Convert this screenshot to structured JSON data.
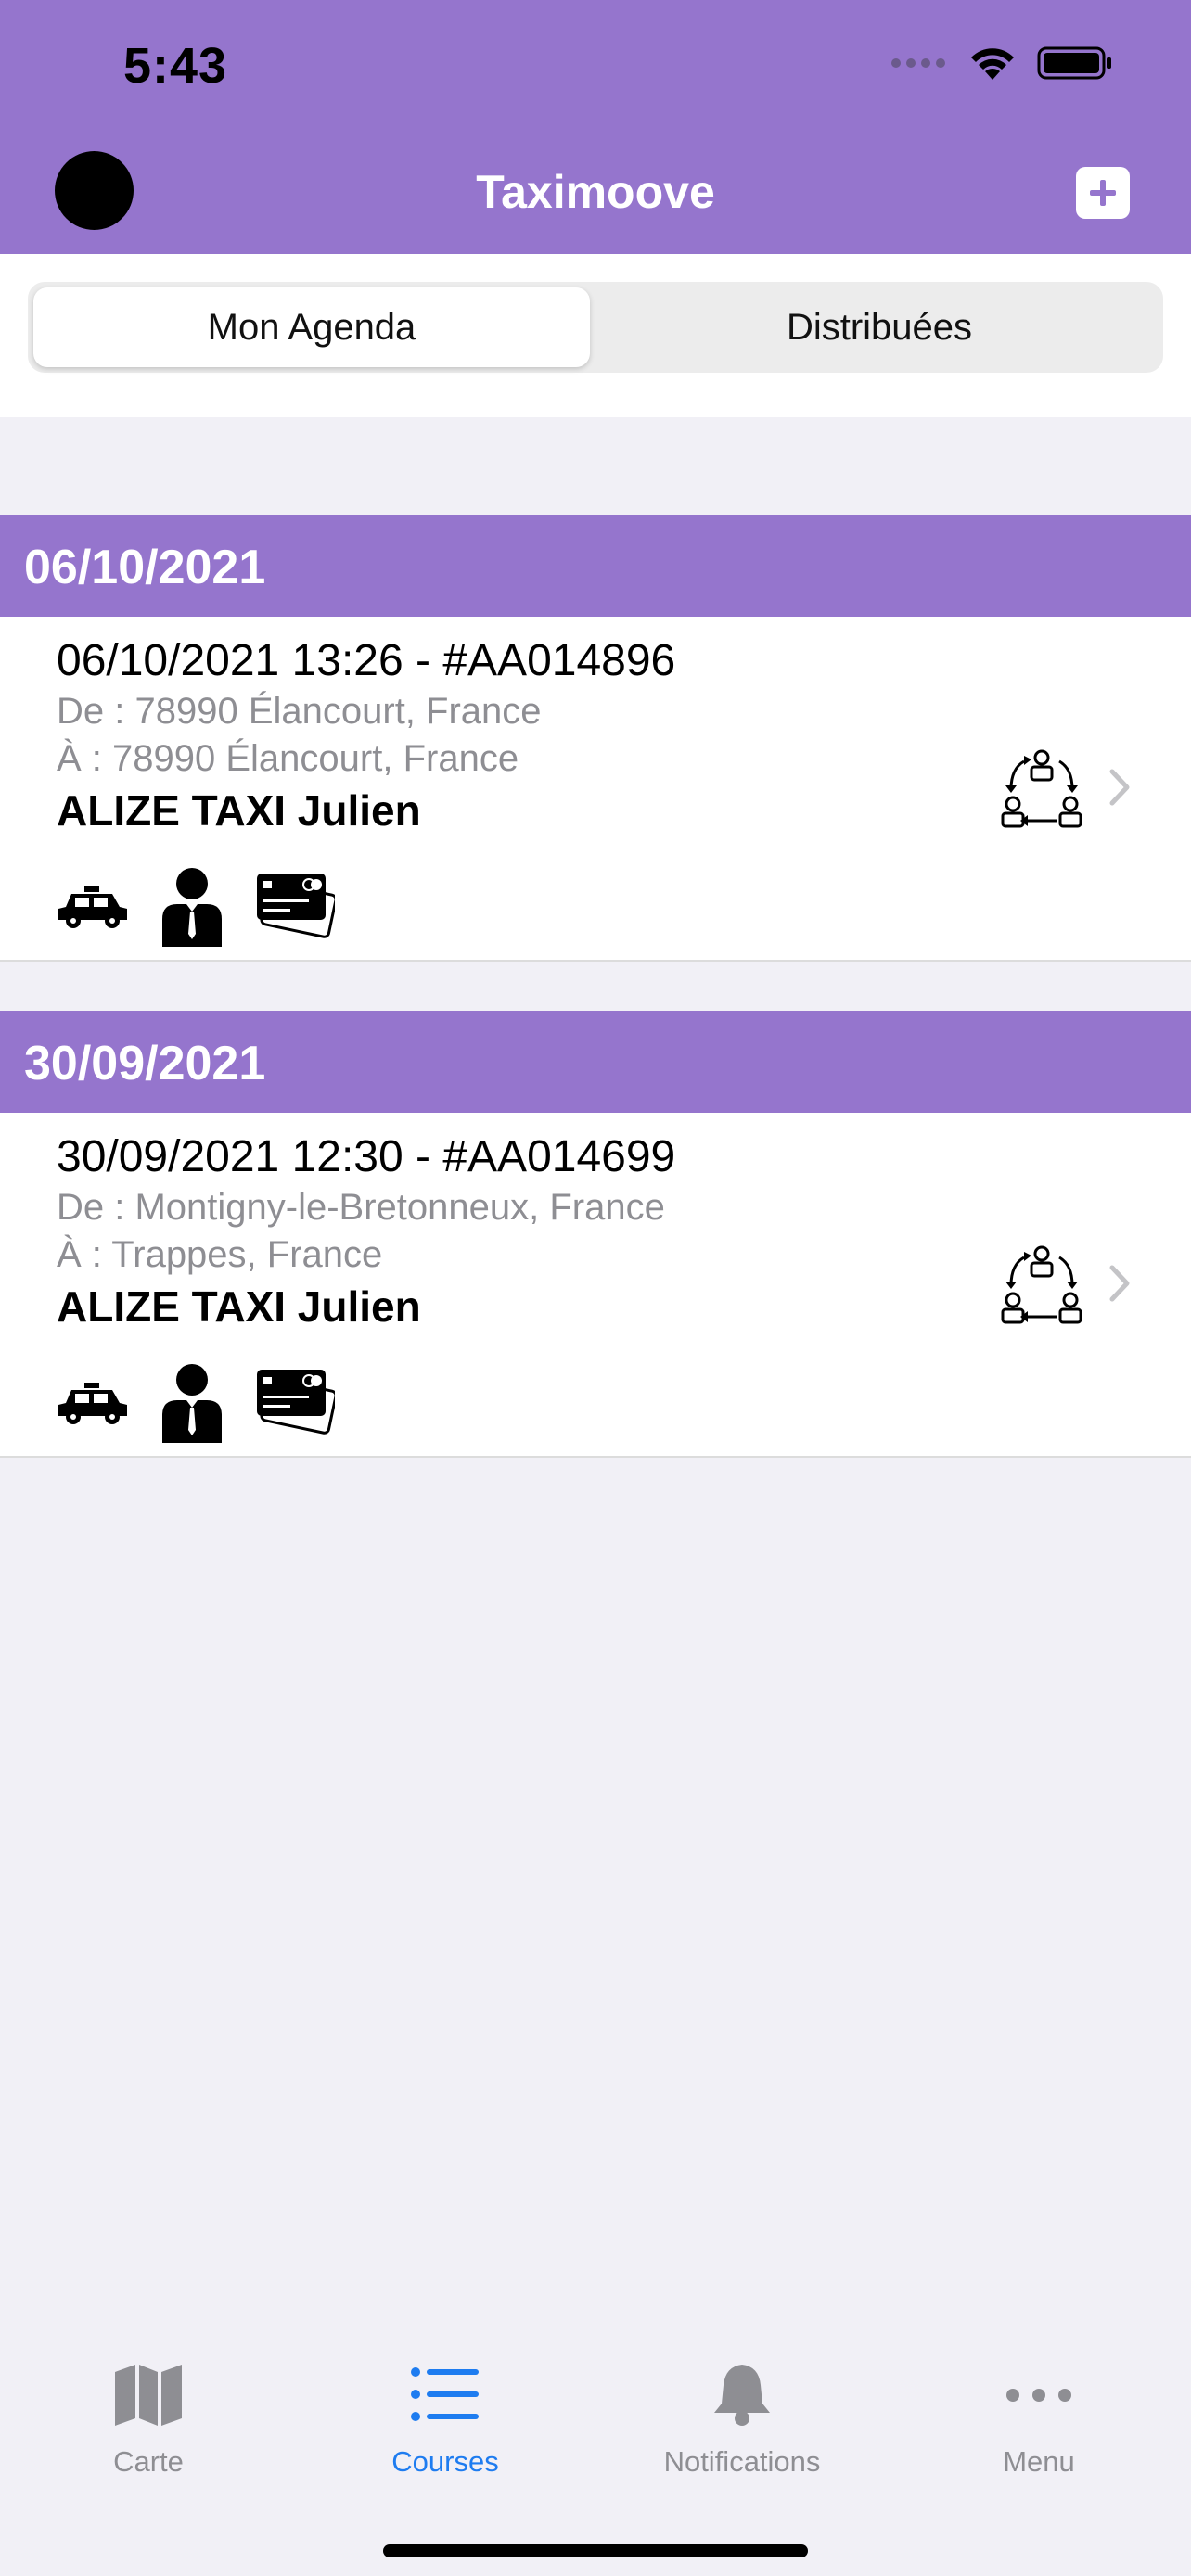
{
  "status_bar": {
    "time": "5:43",
    "icons": [
      "signal-dots-icon",
      "wifi-icon",
      "battery-icon"
    ]
  },
  "nav": {
    "title": "Taximoove",
    "add_icon": "plus-icon"
  },
  "segments": [
    {
      "label": "Mon Agenda",
      "selected": true
    },
    {
      "label": "Distribuées",
      "selected": false
    }
  ],
  "sections": [
    {
      "date": "06/10/2021",
      "rides": [
        {
          "header": "06/10/2021 13:26 - #AA014896",
          "from": "De : 78990 Élancourt, France",
          "to": "À : 78990 Élancourt, France",
          "driver": "ALIZE TAXI Julien",
          "icons": [
            "taxi-car-icon",
            "passenger-icon",
            "credit-card-icon"
          ]
        }
      ]
    },
    {
      "date": "30/09/2021",
      "rides": [
        {
          "header": "30/09/2021 12:30 - #AA014699",
          "from": "De : Montigny-le-Bretonneux, France",
          "to": "À : Trappes, France",
          "driver": "ALIZE TAXI Julien",
          "icons": [
            "taxi-car-icon",
            "passenger-icon",
            "credit-card-icon"
          ]
        }
      ]
    }
  ],
  "tabbar": {
    "tabs": [
      {
        "label": "Carte",
        "icon": "map-icon",
        "active": false
      },
      {
        "label": "Courses",
        "icon": "list-icon",
        "active": true
      },
      {
        "label": "Notifications",
        "icon": "bell-icon",
        "active": false
      },
      {
        "label": "Menu",
        "icon": "more-dots-icon",
        "active": false
      }
    ]
  },
  "colors": {
    "brand": "#9575cd",
    "active_tab": "#1e7cf0",
    "inactive_tab": "#8e8e93",
    "secondary_text": "#8e8e93",
    "background": "#f1f0f6"
  }
}
